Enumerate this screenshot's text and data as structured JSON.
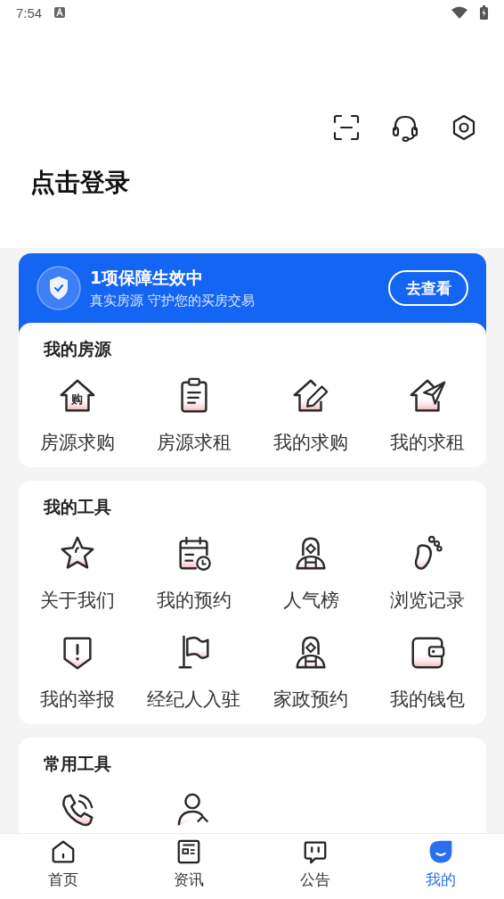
{
  "status_bar": {
    "time": "7:54"
  },
  "header": {
    "login": "点击登录"
  },
  "guarantee": {
    "title": "1项保障生效中",
    "subtitle": "真实房源 守护您的买房交易",
    "button": "去查看"
  },
  "sections": [
    {
      "title": "我的房源",
      "items": [
        {
          "label": "房源求购",
          "badge": "购"
        },
        {
          "label": "房源求租"
        },
        {
          "label": "我的求购"
        },
        {
          "label": "我的求租"
        }
      ]
    },
    {
      "title": "我的工具",
      "items": [
        {
          "label": "关于我们"
        },
        {
          "label": "我的预约"
        },
        {
          "label": "人气榜"
        },
        {
          "label": "浏览记录"
        },
        {
          "label": "我的举报"
        },
        {
          "label": "经纪人入驻"
        },
        {
          "label": "家政预约"
        },
        {
          "label": "我的钱包"
        }
      ]
    },
    {
      "title": "常用工具"
    }
  ],
  "tabs": [
    {
      "label": "首页",
      "selected": false
    },
    {
      "label": "资讯",
      "selected": false
    },
    {
      "label": "公告",
      "selected": false
    },
    {
      "label": "我的",
      "selected": true
    }
  ]
}
